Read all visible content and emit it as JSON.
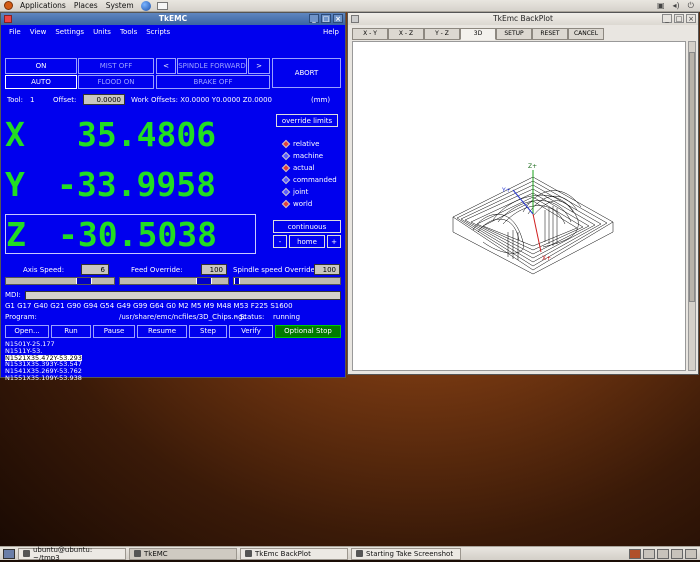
{
  "top_panel": {
    "menus": [
      "Applications",
      "Places",
      "System"
    ]
  },
  "tkemc": {
    "title": "TkEMC",
    "menus": [
      "File",
      "View",
      "Settings",
      "Units",
      "Tools",
      "Scripts"
    ],
    "help": "Help",
    "on": "ON",
    "mist": "MIST OFF",
    "spindle_left": "<",
    "spindle": "SPINDLE FORWARD",
    "spindle_right": ">",
    "abort": "ABORT",
    "auto": "AUTO",
    "flood": "FLOOD ON",
    "brake": "BRAKE OFF",
    "tool_label": "Tool:",
    "tool_value": "1",
    "offset_label": "Offset:",
    "offset_value": "0.0000",
    "work_offsets": "Work Offsets:  X0.0000 Y0.0000 Z0.0000",
    "units": "(mm)",
    "override_limits": "override limits",
    "x_label": "X",
    "x_value": "35.4806",
    "y_label": "Y",
    "y_value": "-33.9958",
    "z_label": "Z",
    "z_value": "-30.5038",
    "coord_modes": [
      "relative",
      "machine",
      "actual",
      "commanded",
      "joint",
      "world"
    ],
    "continuous": "continuous",
    "jog_minus": "-",
    "home": "home",
    "jog_plus": "+",
    "axis_speed_label": "Axis Speed:",
    "axis_speed_value": "6",
    "feed_override_label": "Feed Override:",
    "feed_override_value": "100",
    "spindle_override_label": "Spindle speed Override:",
    "spindle_override_value": "100",
    "mdi_label": "MDI:",
    "modal_codes": "G1 G17 G40 G21 G90 G94 G54 G49 G99 G64 G0 M2 M5 M9 M48 M53 F225 S1600",
    "program_label": "Program:",
    "program_path": "/usr/share/emc/ncfiles/3D_Chips.ngc",
    "status_label": "-  Status:",
    "status_value": "running",
    "actions": [
      "Open...",
      "Run",
      "Pause",
      "Resume",
      "Step",
      "Verify",
      "Optional Stop"
    ],
    "gcode_lines": [
      "N1501Y-25.177",
      "N1511Y-53.",
      "N1521X35.472Y-53.293",
      "N1531X35.393Y-53.547",
      "N1541X35.269Y-53.762",
      "N1551X35.109Y-53.938"
    ]
  },
  "backplot": {
    "title": "TkEmc BackPlot",
    "tabs": [
      "X - Y",
      "X - Z",
      "Y - Z",
      "3D",
      "SETUP",
      "RESET",
      "CANCEL"
    ],
    "axis_z": "Z+",
    "axis_y": "Y+",
    "axis_x": "X+"
  },
  "taskbar": {
    "items": [
      "ubuntu@ubuntu: ~/tmp3",
      "TkEMC",
      "TkEmc BackPlot",
      "Starting Take Screenshot"
    ]
  }
}
